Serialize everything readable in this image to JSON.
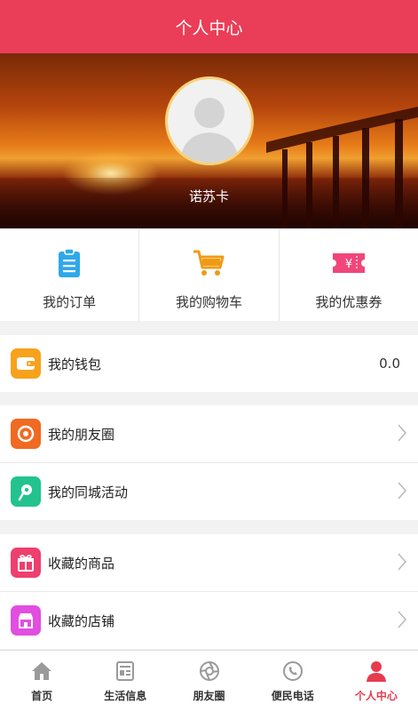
{
  "header": {
    "title": "个人中心"
  },
  "profile": {
    "username": "诺苏卡"
  },
  "quick": [
    {
      "label": "我的订单",
      "icon": "clipboard-icon"
    },
    {
      "label": "我的购物车",
      "icon": "cart-icon"
    },
    {
      "label": "我的优惠券",
      "icon": "coupon-icon"
    }
  ],
  "wallet": {
    "label": "我的钱包",
    "value": "0.0",
    "icon": "wallet-icon"
  },
  "social": [
    {
      "label": "我的朋友圈",
      "icon": "aperture-icon"
    },
    {
      "label": "我的同城活动",
      "icon": "location-pin-icon"
    }
  ],
  "favorites": [
    {
      "label": "收藏的商品",
      "icon": "gift-icon"
    },
    {
      "label": "收藏的店铺",
      "icon": "store-icon"
    }
  ],
  "tabs": [
    {
      "label": "首页",
      "icon": "home-icon"
    },
    {
      "label": "生活信息",
      "icon": "news-icon"
    },
    {
      "label": "朋友圈",
      "icon": "aperture-icon"
    },
    {
      "label": "便民电话",
      "icon": "phone-icon"
    },
    {
      "label": "个人中心",
      "icon": "user-icon"
    }
  ],
  "colors": {
    "brand": "#ea3e58",
    "active_tab": "#e83a4e"
  }
}
